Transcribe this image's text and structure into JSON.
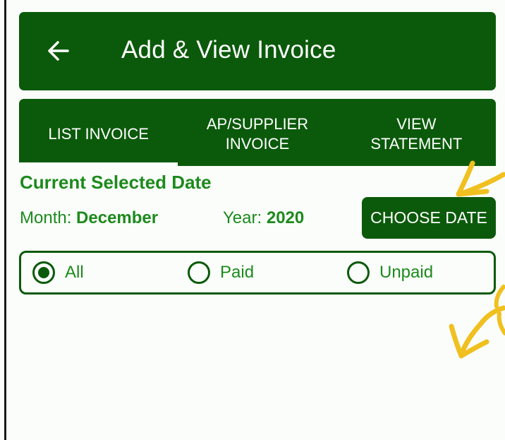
{
  "app_bar": {
    "title": "Add & View Invoice",
    "back_icon": "arrow-left-icon"
  },
  "tabs": [
    {
      "label": "LIST INVOICE",
      "selected": true
    },
    {
      "label": "AP/SUPPLIER INVOICE",
      "selected": false
    },
    {
      "label": "VIEW STATEMENT",
      "selected": false
    }
  ],
  "date_section": {
    "title": "Current Selected Date",
    "month_label": "Month:",
    "month_value": "December",
    "year_label": "Year:",
    "year_value": "2020",
    "choose_button": "CHOOSE DATE"
  },
  "filter": {
    "options": [
      {
        "label": "All",
        "selected": true
      },
      {
        "label": "Paid",
        "selected": false
      },
      {
        "label": "Unpaid",
        "selected": false
      }
    ]
  },
  "colors": {
    "primary": "#0b5a0b",
    "accent_text": "#1d8a1d",
    "annotation": "#f0c020",
    "background": "#fafdfa"
  },
  "annotations": [
    {
      "icon": "yellow-arrow-icon"
    },
    {
      "icon": "yellow-arrow-icon"
    }
  ]
}
